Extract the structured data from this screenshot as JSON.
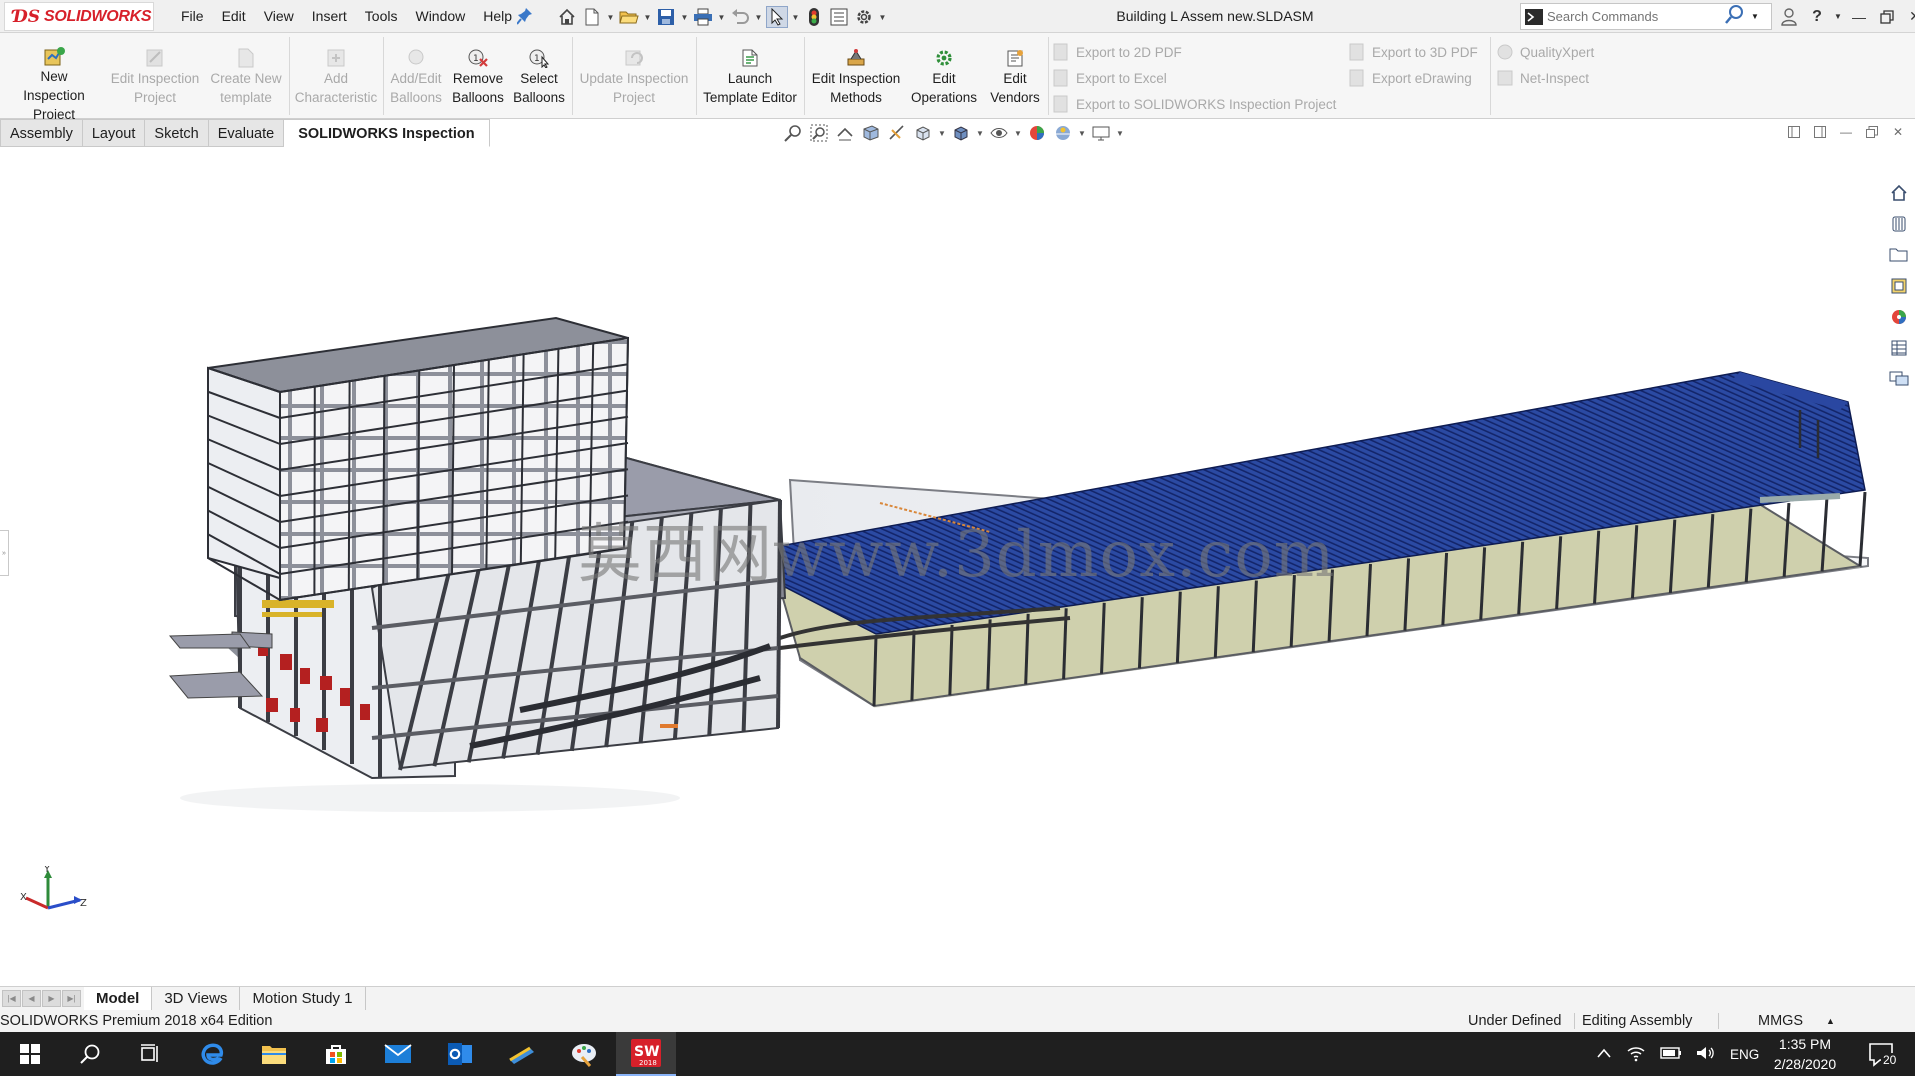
{
  "app": {
    "brand": "SOLIDWORKS",
    "document_title": "Building L Assem new.SLDASM"
  },
  "menu": [
    "File",
    "Edit",
    "View",
    "Insert",
    "Tools",
    "Window",
    "Help"
  ],
  "search": {
    "placeholder": "Search Commands"
  },
  "commands": {
    "new_inspection_project": "New Inspection Project",
    "edit_inspection_project": "Edit Inspection Project",
    "create_new_template": "Create New template",
    "add_characteristic": "Add Characteristic",
    "add_edit_balloons": "Add/Edit Balloons",
    "remove_balloons": "Remove Balloons",
    "select_balloons": "Select Balloons",
    "update_inspection_project": "Update Inspection Project",
    "launch_template_editor": "Launch Template Editor",
    "edit_inspection_methods": "Edit Inspection Methods",
    "edit_operations": "Edit Operations",
    "edit_vendors": "Edit Vendors",
    "export_2d_pdf": "Export to 2D PDF",
    "export_excel": "Export to Excel",
    "export_sw_inspection_project": "Export to SOLIDWORKS Inspection Project",
    "export_3d_pdf": "Export to 3D PDF",
    "export_edrawing": "Export eDrawing",
    "qualityxpert": "QualityXpert",
    "net_inspect": "Net-Inspect"
  },
  "tabs": [
    "Assembly",
    "Layout",
    "Sketch",
    "Evaluate",
    "SOLIDWORKS Inspection"
  ],
  "active_tab": "SOLIDWORKS Inspection",
  "watermark": "莫西网www.3dmox.com",
  "triad": {
    "x": "X",
    "y": "Y",
    "z": "Z"
  },
  "bottom_tabs": [
    "Model",
    "3D Views",
    "Motion Study 1"
  ],
  "active_bottom_tab": "Model",
  "status": {
    "edition": "SOLIDWORKS Premium 2018 x64 Edition",
    "definition": "Under Defined",
    "mode": "Editing Assembly",
    "units": "MMGS"
  },
  "taskbar": {
    "language": "ENG",
    "time": "1:35 PM",
    "date": "2/28/2020",
    "notifications": "20",
    "solidworks_badge": "2018"
  },
  "colors": {
    "brand_red": "#d7202a",
    "roof_blue": "#1f3a8f",
    "wall_khaki": "#cfd0ad",
    "frame_gray": "#9a9ca6",
    "taskbar_bg": "#1f1f1f"
  }
}
